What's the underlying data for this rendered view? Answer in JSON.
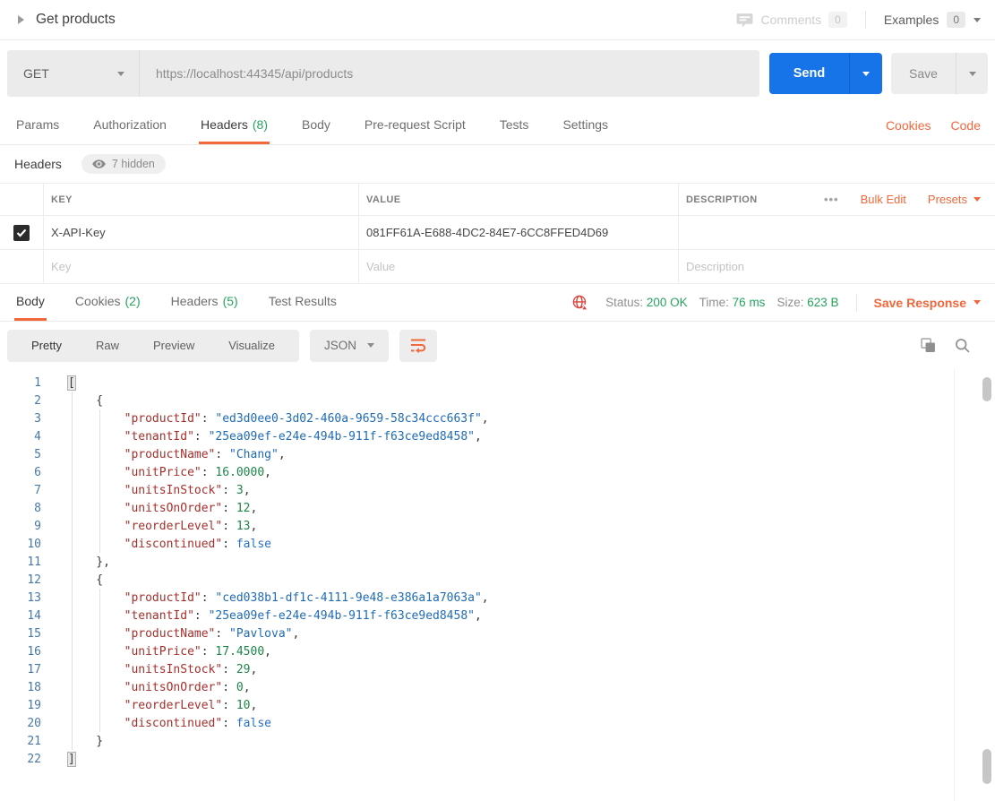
{
  "header": {
    "title": "Get products",
    "comments_label": "Comments",
    "comments_count": "0",
    "examples_label": "Examples",
    "examples_count": "0"
  },
  "request": {
    "method": "GET",
    "url": "https://localhost:44345/api/products",
    "send_label": "Send",
    "save_label": "Save"
  },
  "request_tabs": {
    "items": [
      {
        "label": "Params"
      },
      {
        "label": "Authorization"
      },
      {
        "label": "Headers",
        "count": "(8)"
      },
      {
        "label": "Body"
      },
      {
        "label": "Pre-request Script"
      },
      {
        "label": "Tests"
      },
      {
        "label": "Settings"
      }
    ],
    "cookies_link": "Cookies",
    "code_link": "Code"
  },
  "headers_editor": {
    "title": "Headers",
    "hidden_badge": "7 hidden",
    "columns": {
      "key": "KEY",
      "value": "VALUE",
      "description": "DESCRIPTION"
    },
    "more_options": "•••",
    "bulk_edit": "Bulk Edit",
    "presets": "Presets",
    "rows": [
      {
        "key": "X-API-Key",
        "value": "081FF61A-E688-4DC2-84E7-6CC8FFED4D69",
        "description": ""
      }
    ],
    "placeholder_row": {
      "key": "Key",
      "value": "Value",
      "description": "Description"
    }
  },
  "response": {
    "tabs": [
      {
        "label": "Body"
      },
      {
        "label": "Cookies",
        "count": "(2)"
      },
      {
        "label": "Headers",
        "count": "(5)"
      },
      {
        "label": "Test Results"
      }
    ],
    "status_label": "Status:",
    "status_value": "200 OK",
    "time_label": "Time:",
    "time_value": "76 ms",
    "size_label": "Size:",
    "size_value": "623 B",
    "save_response": "Save Response"
  },
  "viewer": {
    "modes": [
      "Pretty",
      "Raw",
      "Preview",
      "Visualize"
    ],
    "active_mode": "Pretty",
    "format": "JSON"
  },
  "colors": {
    "accent_orange": "#f0683c",
    "success_green": "#26a35f",
    "send_blue": "#1673e8",
    "error_red": "#d9453d"
  },
  "response_body": {
    "lines": [
      {
        "num": 1,
        "tokens": [
          {
            "t": "hl",
            "v": "["
          }
        ]
      },
      {
        "num": 2,
        "tokens": [
          {
            "t": "p",
            "v": "    {"
          }
        ]
      },
      {
        "num": 3,
        "tokens": [
          {
            "t": "p",
            "v": "        "
          },
          {
            "t": "k",
            "v": "\"productId\""
          },
          {
            "t": "p",
            "v": ": "
          },
          {
            "t": "s",
            "v": "\"ed3d0ee0-3d02-460a-9659-58c34ccc663f\""
          },
          {
            "t": "p",
            "v": ","
          }
        ]
      },
      {
        "num": 4,
        "tokens": [
          {
            "t": "p",
            "v": "        "
          },
          {
            "t": "k",
            "v": "\"tenantId\""
          },
          {
            "t": "p",
            "v": ": "
          },
          {
            "t": "s",
            "v": "\"25ea09ef-e24e-494b-911f-f63ce9ed8458\""
          },
          {
            "t": "p",
            "v": ","
          }
        ]
      },
      {
        "num": 5,
        "tokens": [
          {
            "t": "p",
            "v": "        "
          },
          {
            "t": "k",
            "v": "\"productName\""
          },
          {
            "t": "p",
            "v": ": "
          },
          {
            "t": "s",
            "v": "\"Chang\""
          },
          {
            "t": "p",
            "v": ","
          }
        ]
      },
      {
        "num": 6,
        "tokens": [
          {
            "t": "p",
            "v": "        "
          },
          {
            "t": "k",
            "v": "\"unitPrice\""
          },
          {
            "t": "p",
            "v": ": "
          },
          {
            "t": "n",
            "v": "16.0000"
          },
          {
            "t": "p",
            "v": ","
          }
        ]
      },
      {
        "num": 7,
        "tokens": [
          {
            "t": "p",
            "v": "        "
          },
          {
            "t": "k",
            "v": "\"unitsInStock\""
          },
          {
            "t": "p",
            "v": ": "
          },
          {
            "t": "n",
            "v": "3"
          },
          {
            "t": "p",
            "v": ","
          }
        ]
      },
      {
        "num": 8,
        "tokens": [
          {
            "t": "p",
            "v": "        "
          },
          {
            "t": "k",
            "v": "\"unitsOnOrder\""
          },
          {
            "t": "p",
            "v": ": "
          },
          {
            "t": "n",
            "v": "12"
          },
          {
            "t": "p",
            "v": ","
          }
        ]
      },
      {
        "num": 9,
        "tokens": [
          {
            "t": "p",
            "v": "        "
          },
          {
            "t": "k",
            "v": "\"reorderLevel\""
          },
          {
            "t": "p",
            "v": ": "
          },
          {
            "t": "n",
            "v": "13"
          },
          {
            "t": "p",
            "v": ","
          }
        ]
      },
      {
        "num": 10,
        "tokens": [
          {
            "t": "p",
            "v": "        "
          },
          {
            "t": "k",
            "v": "\"discontinued\""
          },
          {
            "t": "p",
            "v": ": "
          },
          {
            "t": "b",
            "v": "false"
          }
        ]
      },
      {
        "num": 11,
        "tokens": [
          {
            "t": "p",
            "v": "    },"
          }
        ]
      },
      {
        "num": 12,
        "tokens": [
          {
            "t": "p",
            "v": "    {"
          }
        ]
      },
      {
        "num": 13,
        "tokens": [
          {
            "t": "p",
            "v": "        "
          },
          {
            "t": "k",
            "v": "\"productId\""
          },
          {
            "t": "p",
            "v": ": "
          },
          {
            "t": "s",
            "v": "\"ced038b1-df1c-4111-9e48-e386a1a7063a\""
          },
          {
            "t": "p",
            "v": ","
          }
        ]
      },
      {
        "num": 14,
        "tokens": [
          {
            "t": "p",
            "v": "        "
          },
          {
            "t": "k",
            "v": "\"tenantId\""
          },
          {
            "t": "p",
            "v": ": "
          },
          {
            "t": "s",
            "v": "\"25ea09ef-e24e-494b-911f-f63ce9ed8458\""
          },
          {
            "t": "p",
            "v": ","
          }
        ]
      },
      {
        "num": 15,
        "tokens": [
          {
            "t": "p",
            "v": "        "
          },
          {
            "t": "k",
            "v": "\"productName\""
          },
          {
            "t": "p",
            "v": ": "
          },
          {
            "t": "s",
            "v": "\"Pavlova\""
          },
          {
            "t": "p",
            "v": ","
          }
        ]
      },
      {
        "num": 16,
        "tokens": [
          {
            "t": "p",
            "v": "        "
          },
          {
            "t": "k",
            "v": "\"unitPrice\""
          },
          {
            "t": "p",
            "v": ": "
          },
          {
            "t": "n",
            "v": "17.4500"
          },
          {
            "t": "p",
            "v": ","
          }
        ]
      },
      {
        "num": 17,
        "tokens": [
          {
            "t": "p",
            "v": "        "
          },
          {
            "t": "k",
            "v": "\"unitsInStock\""
          },
          {
            "t": "p",
            "v": ": "
          },
          {
            "t": "n",
            "v": "29"
          },
          {
            "t": "p",
            "v": ","
          }
        ]
      },
      {
        "num": 18,
        "tokens": [
          {
            "t": "p",
            "v": "        "
          },
          {
            "t": "k",
            "v": "\"unitsOnOrder\""
          },
          {
            "t": "p",
            "v": ": "
          },
          {
            "t": "n",
            "v": "0"
          },
          {
            "t": "p",
            "v": ","
          }
        ]
      },
      {
        "num": 19,
        "tokens": [
          {
            "t": "p",
            "v": "        "
          },
          {
            "t": "k",
            "v": "\"reorderLevel\""
          },
          {
            "t": "p",
            "v": ": "
          },
          {
            "t": "n",
            "v": "10"
          },
          {
            "t": "p",
            "v": ","
          }
        ]
      },
      {
        "num": 20,
        "tokens": [
          {
            "t": "p",
            "v": "        "
          },
          {
            "t": "k",
            "v": "\"discontinued\""
          },
          {
            "t": "p",
            "v": ": "
          },
          {
            "t": "b",
            "v": "false"
          }
        ]
      },
      {
        "num": 21,
        "tokens": [
          {
            "t": "p",
            "v": "    }"
          }
        ]
      },
      {
        "num": 22,
        "tokens": [
          {
            "t": "hl",
            "v": "]"
          }
        ]
      }
    ]
  }
}
